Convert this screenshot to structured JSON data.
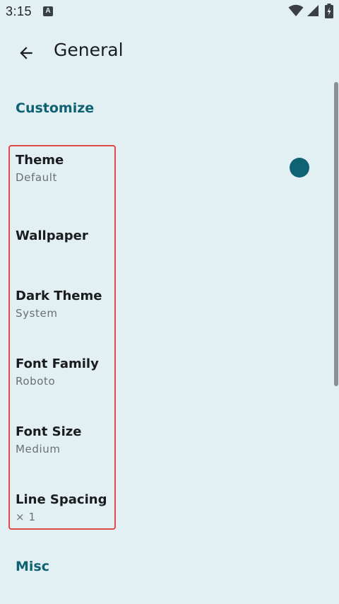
{
  "status_bar": {
    "time": "3:15",
    "notification_icon": "a-icon",
    "icons": [
      "wifi-icon",
      "signal-icon",
      "battery-icon"
    ]
  },
  "app_bar": {
    "title": "General",
    "back_icon": "arrow-back-icon"
  },
  "sections": {
    "customize": {
      "header": "Customize",
      "items": [
        {
          "title": "Theme",
          "subtitle": "Default"
        },
        {
          "title": "Wallpaper"
        },
        {
          "title": "Dark Theme",
          "subtitle": "System"
        },
        {
          "title": "Font Family",
          "subtitle": "Roboto"
        },
        {
          "title": "Font Size",
          "subtitle": "Medium"
        },
        {
          "title": "Line Spacing",
          "subtitle": "× 1"
        }
      ]
    },
    "misc": {
      "header": "Misc"
    }
  },
  "colors": {
    "background": "#e2eff3",
    "accent": "#0e6271",
    "highlight": "#e04848"
  }
}
